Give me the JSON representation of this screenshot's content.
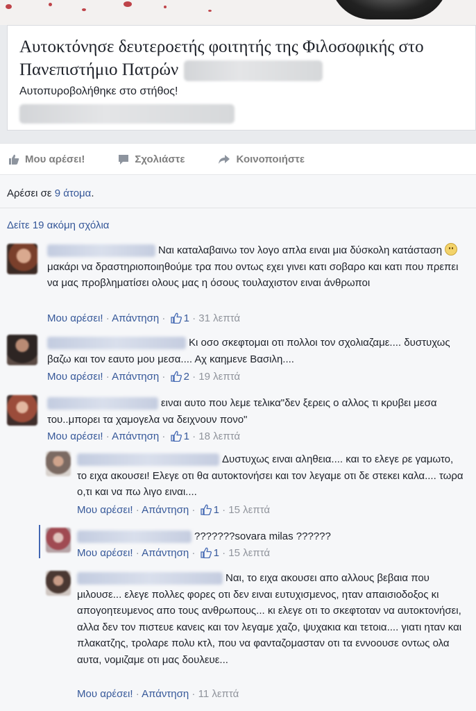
{
  "post": {
    "headline": "Αυτοκτόνησε δευτεροετής φοιτητής της Φιλοσοφικής στο Πανεπιστήμιο Πατρών",
    "subtitle": "Αυτοπυροβολήθηκε στο στήθος!"
  },
  "actions": {
    "like": "Μου αρέσει!",
    "comment": "Σχολιάστε",
    "share": "Κοινοποιήστε"
  },
  "likes": {
    "prefix": "Αρέσει σε ",
    "link": "9 άτομα",
    "suffix": "."
  },
  "view_more": "Δείτε 19 ακόμη σχόλια",
  "meta_labels": {
    "like": "Μου αρέσει!",
    "reply": "Απάντηση",
    "sep": " · "
  },
  "comments": [
    {
      "text_a": "Ναι καταλαβαινω τον λογο απλα ειναι μια δύσκολη κατάσταση",
      "text_b": " μακάρι να δραστηριοποιηθούμε τρα που οντως εχει γινει κατι σοβαρο και κατι που πρεπει να μας προβληματίσει ολους μας η όσους τουλαχιστον ειναι άνθρωποι",
      "likes": "1",
      "time": "31 λεπτά"
    },
    {
      "text_a": "Κι οσο σκεφτομαι οτι πολλοι τον σχολιαζαμε.... δυστυχως βαζω και τον εαυτο μου μεσα.... Αχ καημενε Βασιλη....",
      "likes": "2",
      "time": "19 λεπτά"
    },
    {
      "text_a": "ειναι αυτο που λεμε τελικα\"δεν ξερεις ο αλλος τι κρυβει μεσα του..μπορει τα χαμογελα να δειχνουν πονο\"",
      "likes": "1",
      "time": "18 λεπτά"
    }
  ],
  "replies": [
    {
      "text_a": "Δυστυχως ειναι αληθεια.... και το ελεγε ρε γαμωτο, το ειχα ακουσει! Ελεγε οτι θα αυτοκτονήσει και τον λεγαμε οτι δε στεκει καλα.... τωρα ο,τι και να πω λιγο ειναι....",
      "likes": "1",
      "time": "15 λεπτά"
    },
    {
      "text_a": "???????sovara milas ??????",
      "likes": "1",
      "time": "15 λεπτά"
    },
    {
      "text_a": "Ναι, το ειχα ακουσει απο αλλους βεβαια που μιλουσε... ελεγε πολλες φορες οτι δεν ειναι ευτυχισμενος, ηταν απαισιοδοξος κι απογοητευμενος απο τους ανθρωπους... κι ελεγε οτι το σκεφτοταν να αυτοκτονήσει, αλλα δεν τον πιστευε κανεις και τον λεγαμε χαζο, ψυχακια και τετοια.... γιατι ηταν και πλακατζης, τρολαρε πολυ κτλ, που να φανταζομασταν οτι τα εννοουσε οντως ολα αυτα, νομιζαμε οτι μας δουλευε...",
      "time": "11 λεπτά"
    }
  ],
  "colors": {
    "link": "#365899",
    "meta": "#90949c",
    "background": "#f6f7f9"
  }
}
